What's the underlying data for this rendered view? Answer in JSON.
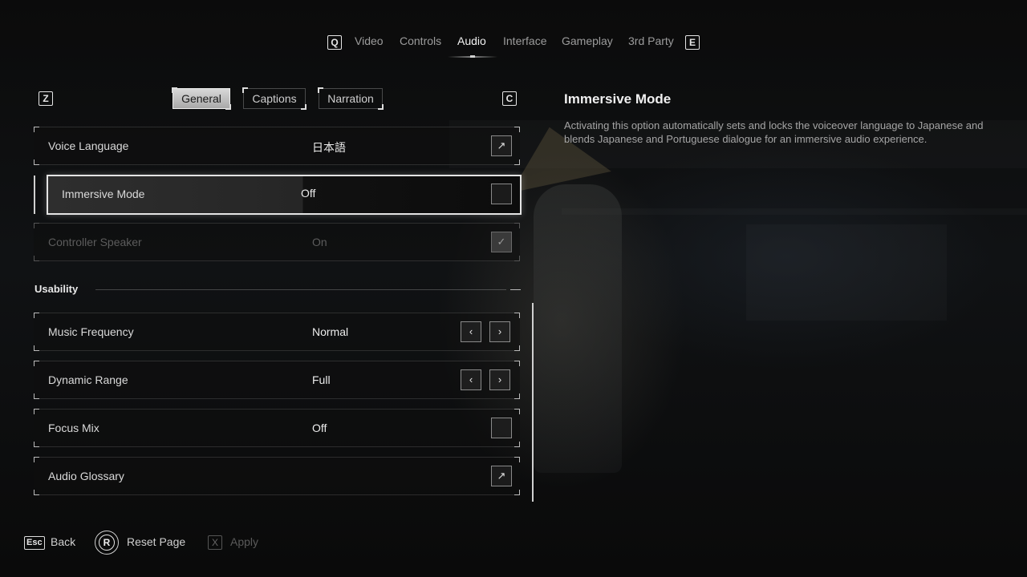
{
  "top_nav": {
    "left_key": "Q",
    "right_key": "E",
    "tabs": [
      "Video",
      "Controls",
      "Audio",
      "Interface",
      "Gameplay",
      "3rd Party"
    ],
    "active_tab": "Audio"
  },
  "sub_nav": {
    "left_key": "Z",
    "right_key": "C",
    "tabs": [
      "General",
      "Captions",
      "Narration"
    ],
    "active_tab": "General"
  },
  "settings": {
    "voice_language": {
      "label": "Voice Language",
      "value": "日本語"
    },
    "immersive_mode": {
      "label": "Immersive Mode",
      "value": "Off"
    },
    "controller_speaker": {
      "label": "Controller Speaker",
      "value": "On",
      "check": "✓"
    },
    "usability": {
      "title": "Usability",
      "collapse": "—",
      "music_frequency": {
        "label": "Music Frequency",
        "value": "Normal"
      },
      "dynamic_range": {
        "label": "Dynamic Range",
        "value": "Full"
      },
      "focus_mix": {
        "label": "Focus Mix",
        "value": "Off"
      },
      "audio_glossary": {
        "label": "Audio Glossary"
      }
    }
  },
  "icons": {
    "external": "↗",
    "prev": "‹",
    "next": "›"
  },
  "info_panel": {
    "title": "Immersive Mode",
    "description": "Activating this option automatically sets and locks the voiceover language to Japanese and blends Japanese and Portuguese dialogue for an immersive audio experience."
  },
  "footer": {
    "back_key": "Esc",
    "back_label": "Back",
    "reset_key": "R",
    "reset_label": "Reset Page",
    "apply_key": "X",
    "apply_label": "Apply"
  }
}
